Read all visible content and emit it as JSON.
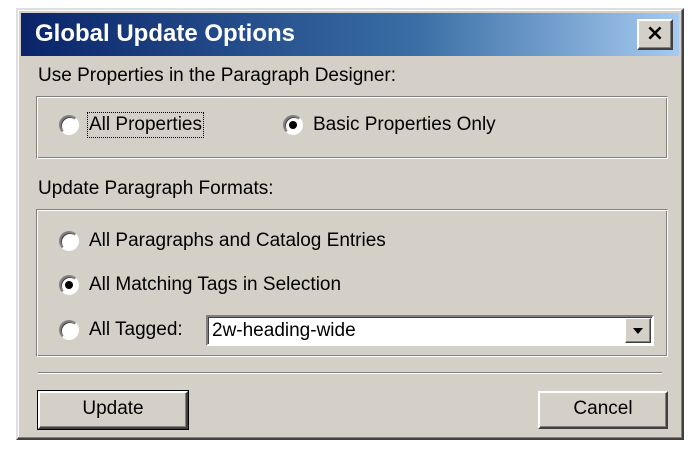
{
  "window": {
    "title": "Global Update Options",
    "close_label": "×"
  },
  "properties": {
    "label": "Use Properties in the Paragraph Designer:",
    "options": [
      {
        "label": "All Properties",
        "checked": false,
        "focused": true
      },
      {
        "label": "Basic Properties Only",
        "checked": true
      }
    ]
  },
  "formats": {
    "label": "Update Paragraph Formats:",
    "options": [
      {
        "label": "All Paragraphs and Catalog Entries",
        "checked": false
      },
      {
        "label": "All Matching Tags in Selection",
        "checked": true
      },
      {
        "label": "All Tagged:",
        "checked": false
      }
    ],
    "tag_dropdown": {
      "value": "2w-heading-wide"
    }
  },
  "buttons": {
    "update": "Update",
    "cancel": "Cancel"
  }
}
